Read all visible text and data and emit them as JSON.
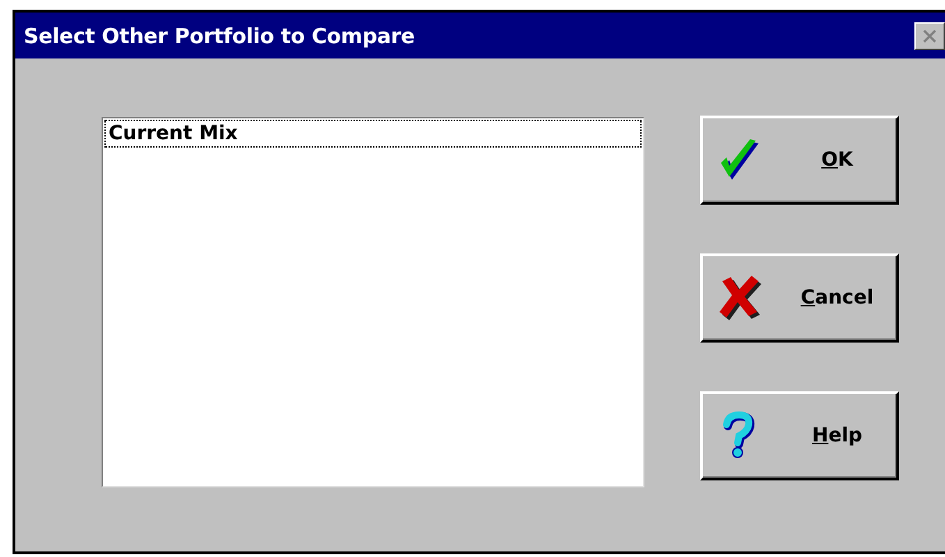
{
  "window": {
    "title": "Select Other Portfolio to Compare"
  },
  "list": {
    "items": [
      {
        "label": "Current Mix",
        "selected": false,
        "focused": true
      }
    ]
  },
  "buttons": [
    {
      "kind": "ok",
      "label": "OK",
      "underline_first": true
    },
    {
      "kind": "cancel",
      "label": "Cancel",
      "underline_first": true
    },
    {
      "kind": "help",
      "label": "Help",
      "underline_first": true
    }
  ]
}
